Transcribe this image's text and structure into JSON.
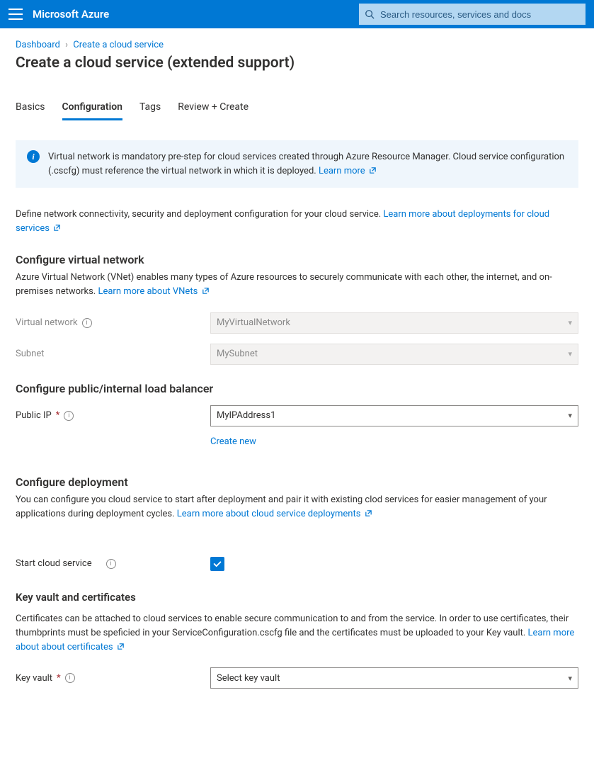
{
  "topbar": {
    "brand": "Microsoft Azure",
    "search_placeholder": "Search resources, services and docs"
  },
  "breadcrumb": {
    "root": "Dashboard",
    "current": "Create a cloud service"
  },
  "page_title": "Create a cloud service (extended support)",
  "tabs": {
    "basics": "Basics",
    "configuration": "Configuration",
    "tags": "Tags",
    "review": "Review + Create"
  },
  "infobox": {
    "text": "Virtual network is mandatory pre-step for cloud services created through Azure Resource Manager. Cloud service configuration (.cscfg) must reference the virtual network in which it is deployed. ",
    "link": "Learn more"
  },
  "intro": {
    "text": "Define network connectivity, security and deployment configuration for your cloud service. ",
    "link": "Learn more about deployments for cloud services"
  },
  "vnet": {
    "heading": "Configure virtual network",
    "desc": "Azure Virtual Network (VNet) enables many types of Azure resources to securely communicate with each other, the internet, and on-premises networks. ",
    "link": "Learn more about VNets",
    "label_vnet": "Virtual network",
    "value_vnet": "MyVirtualNetwork",
    "label_subnet": "Subnet",
    "value_subnet": "MySubnet"
  },
  "lb": {
    "heading": "Configure public/internal load balancer",
    "label_ip": "Public IP",
    "value_ip": "MyIPAddress1",
    "create_new": "Create new"
  },
  "deploy": {
    "heading": "Configure deployment",
    "desc": "You can configure you cloud service to start after deployment and pair it with existing clod services for easier management of your applications during deployment cycles. ",
    "link": "Learn more about cloud service deployments",
    "label_start": "Start cloud service"
  },
  "kv": {
    "heading": "Key vault and certificates",
    "desc": "Certificates can be attached to cloud services to enable secure communication to and from the service. In order to use certificates, their thumbprints must be speficied in your ServiceConfiguration.cscfg file and the certificates must be uploaded to your Key vault. ",
    "link": "Learn more about about certificates",
    "label_kv": "Key vault",
    "value_kv": "Select key vault"
  }
}
